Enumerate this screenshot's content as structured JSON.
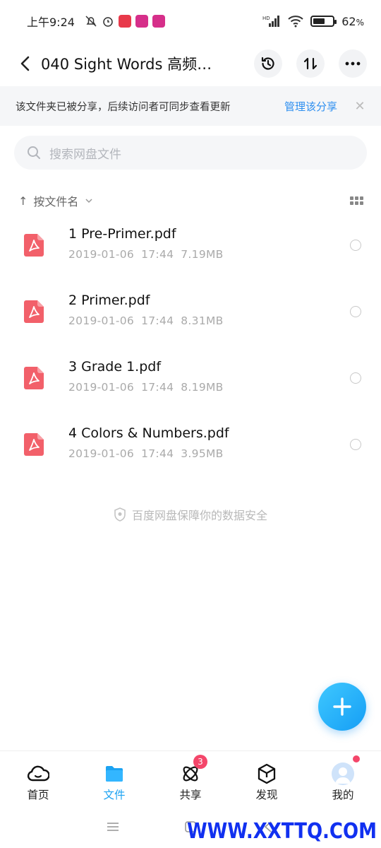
{
  "status_bar": {
    "time": "上午9:24",
    "battery_percent": "62",
    "battery_unit": "%",
    "battery_level": 0.62,
    "network": "HD"
  },
  "header": {
    "title": "040 Sight Words 高频…",
    "back_icon": "chevron-left-icon",
    "actions": [
      "history-icon",
      "sort-arrows-icon",
      "more-icon"
    ]
  },
  "share_banner": {
    "text": "该文件夹已被分享，后续访问者可同步查看更新",
    "manage_label": "管理该分享",
    "close_glyph": "✕"
  },
  "search": {
    "placeholder": "搜索网盘文件"
  },
  "sort": {
    "label": "按文件名",
    "arrow": "↑"
  },
  "files": [
    {
      "name": "1 Pre-Primer.pdf",
      "date": "2019-01-06",
      "time": "17:44",
      "size": "7.19MB"
    },
    {
      "name": "2 Primer.pdf",
      "date": "2019-01-06",
      "time": "17:44",
      "size": "8.31MB"
    },
    {
      "name": "3 Grade 1.pdf",
      "date": "2019-01-06",
      "time": "17:44",
      "size": "8.19MB"
    },
    {
      "name": "4 Colors & Numbers.pdf",
      "date": "2019-01-06",
      "time": "17:44",
      "size": "3.95MB"
    }
  ],
  "security_note": "百度网盘保障你的数据安全",
  "tabs": [
    {
      "label": "首页",
      "icon": "cloud-home-icon"
    },
    {
      "label": "文件",
      "icon": "folder-icon",
      "active": true
    },
    {
      "label": "共享",
      "icon": "atom-share-icon",
      "badge": "3"
    },
    {
      "label": "发现",
      "icon": "cube-discover-icon"
    },
    {
      "label": "我的",
      "icon": "avatar-icon",
      "dot": true
    }
  ],
  "watermark": "WWW.XXTTQ.COM",
  "colors": {
    "accent": "#1ca3f2",
    "link": "#2d8ff0",
    "pdf_red": "#f2606a",
    "badge_red": "#f4466a"
  }
}
